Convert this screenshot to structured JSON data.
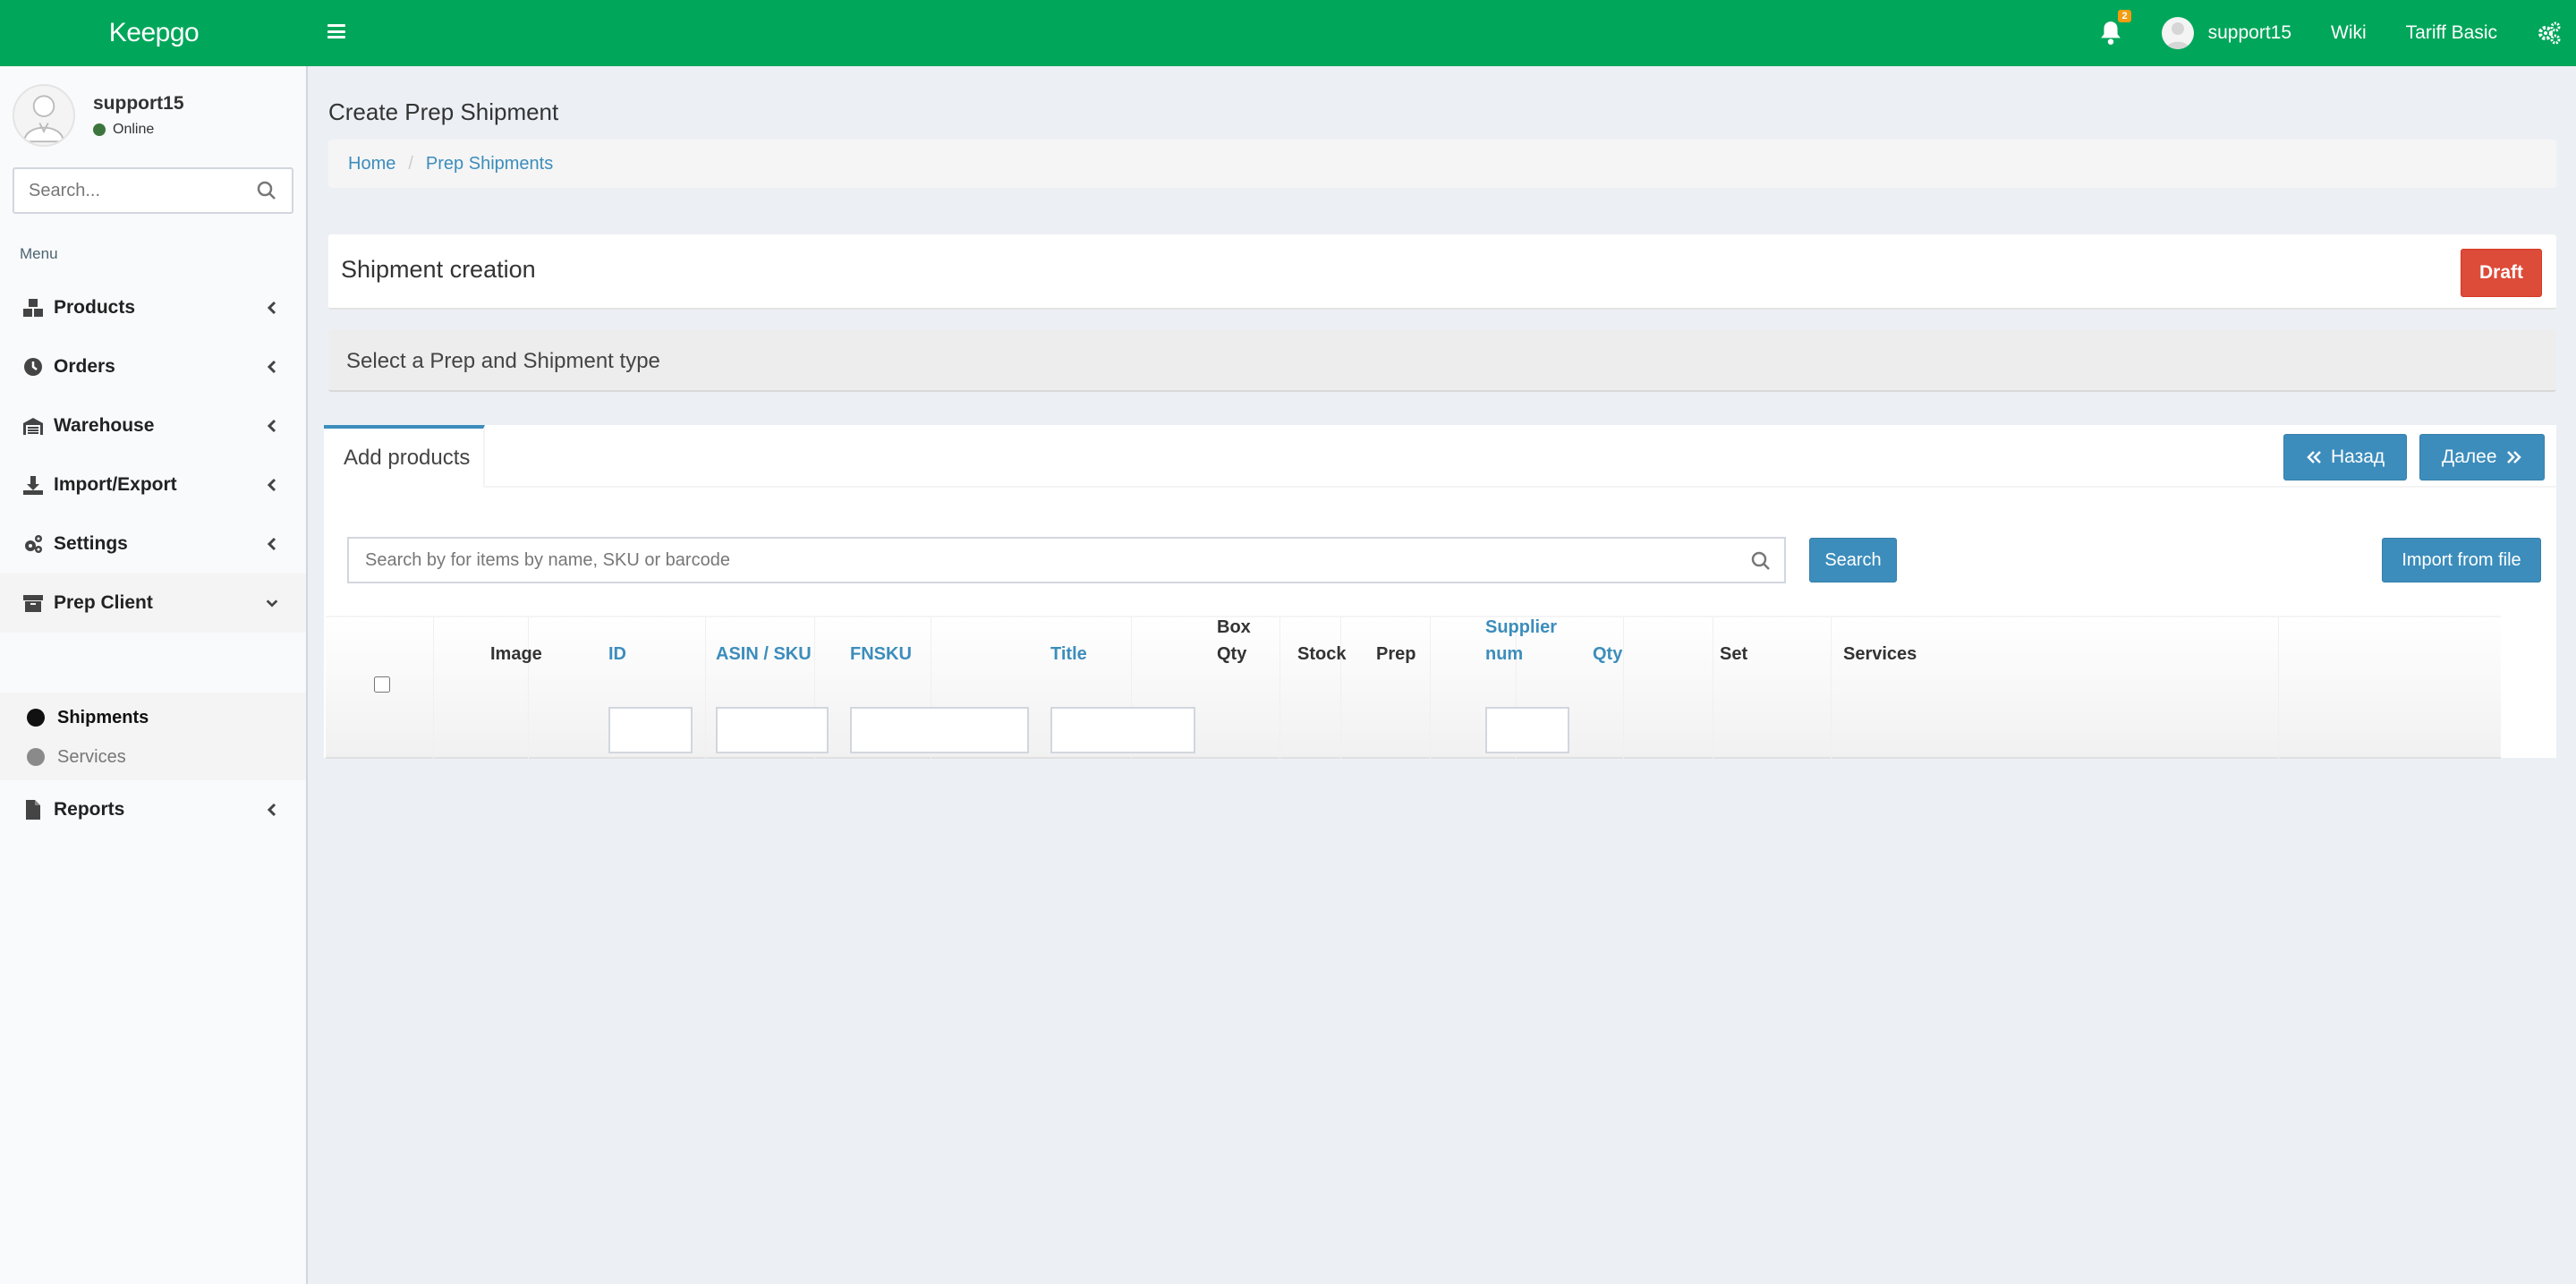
{
  "header": {
    "logo": "Keepgo",
    "notifications_count": "2",
    "username": "support15",
    "links": {
      "wiki": "Wiki",
      "tariff": "Tariff Basic"
    },
    "accent_color": "#00a65a"
  },
  "sidebar": {
    "user": {
      "name": "support15",
      "status": "Online"
    },
    "search_placeholder": "Search...",
    "menu_header": "Menu",
    "items": [
      {
        "label": "Products",
        "icon": "cubes-icon"
      },
      {
        "label": "Orders",
        "icon": "clock-icon"
      },
      {
        "label": "Warehouse",
        "icon": "warehouse-icon"
      },
      {
        "label": "Import/Export",
        "icon": "download-icon"
      },
      {
        "label": "Settings",
        "icon": "cogs-icon"
      },
      {
        "label": "Prep Client",
        "icon": "archive-icon"
      },
      {
        "label": "Reports",
        "icon": "file-icon"
      }
    ],
    "submenu": [
      {
        "label": "Shipments"
      },
      {
        "label": "Services"
      }
    ]
  },
  "page": {
    "title": "Create Prep Shipment",
    "breadcrumb": [
      "Home",
      "Prep Shipments"
    ]
  },
  "shipment": {
    "title": "Shipment creation",
    "status": "Draft",
    "step_title": "Select a Prep and Shipment type"
  },
  "products_tab": {
    "tab_label": "Add products",
    "back_label": "Назад",
    "next_label": "Далее",
    "search_placeholder": "Search by for items by name, SKU or barcode",
    "search_button": "Search",
    "import_button": "Import from file"
  },
  "table": {
    "columns": {
      "image": "Image",
      "id": "ID",
      "asin_sku": "ASIN / SKU",
      "fnsku": "FNSKU",
      "title": "Title",
      "box_qty_1": "Box",
      "box_qty_2": "Qty",
      "stock": "Stock",
      "prep": "Prep",
      "supplier_1": "Supplier",
      "supplier_2": "num",
      "qty": "Qty",
      "set": "Set",
      "services": "Services"
    },
    "rows": []
  }
}
